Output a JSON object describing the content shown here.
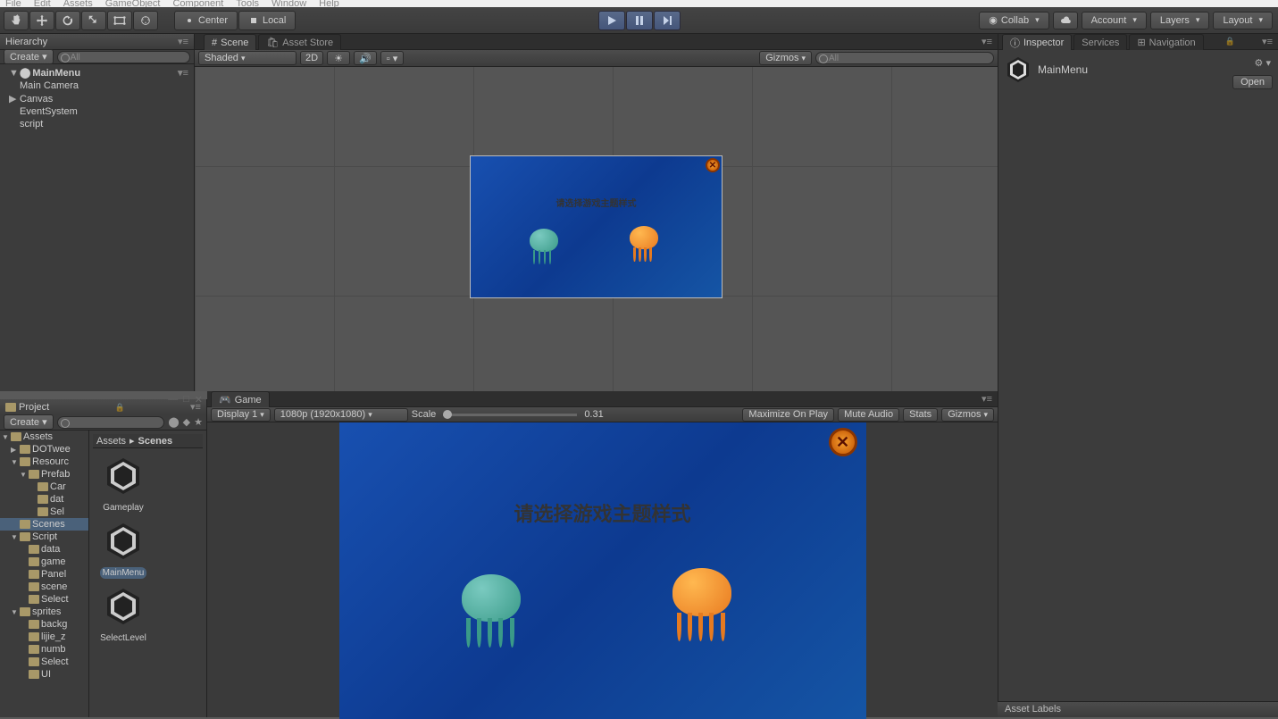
{
  "menubar": [
    "File",
    "Edit",
    "Assets",
    "GameObject",
    "Component",
    "Tools",
    "Window",
    "Help"
  ],
  "toolbar": {
    "pivot_center": "Center",
    "pivot_local": "Local",
    "collab": "Collab",
    "account": "Account",
    "layers": "Layers",
    "layout": "Layout"
  },
  "hierarchy": {
    "title": "Hierarchy",
    "create": "Create",
    "search_placeholder": "All",
    "scene": "MainMenu",
    "items": [
      "Main Camera",
      "Canvas",
      "EventSystem",
      "script"
    ]
  },
  "scene": {
    "tab_scene": "Scene",
    "tab_asset_store": "Asset Store",
    "shaded": "Shaded",
    "mode_2d": "2D",
    "gizmos": "Gizmos",
    "search_placeholder": "All"
  },
  "game": {
    "tab": "Game",
    "display": "Display 1",
    "resolution": "1080p (1920x1080)",
    "scale_label": "Scale",
    "scale_value": "0.31",
    "maximize": "Maximize On Play",
    "mute": "Mute Audio",
    "stats": "Stats",
    "gizmos": "Gizmos"
  },
  "game_content": {
    "title": "请选择游戏主题样式"
  },
  "project": {
    "title": "Project",
    "create": "Create",
    "breadcrumb_root": "Assets",
    "breadcrumb_cur": "Scenes",
    "tree": [
      {
        "name": "Assets",
        "depth": 0,
        "fold": "▼"
      },
      {
        "name": "DOTwee",
        "depth": 1,
        "fold": "▶"
      },
      {
        "name": "Resourc",
        "depth": 1,
        "fold": "▼"
      },
      {
        "name": "Prefab",
        "depth": 2,
        "fold": "▼"
      },
      {
        "name": "Car",
        "depth": 3,
        "fold": ""
      },
      {
        "name": "dat",
        "depth": 3,
        "fold": ""
      },
      {
        "name": "Sel",
        "depth": 3,
        "fold": ""
      },
      {
        "name": "Scenes",
        "depth": 1,
        "fold": "",
        "selected": true
      },
      {
        "name": "Script",
        "depth": 1,
        "fold": "▼"
      },
      {
        "name": "data",
        "depth": 2,
        "fold": ""
      },
      {
        "name": "game",
        "depth": 2,
        "fold": ""
      },
      {
        "name": "Panel",
        "depth": 2,
        "fold": ""
      },
      {
        "name": "scene",
        "depth": 2,
        "fold": ""
      },
      {
        "name": "Select",
        "depth": 2,
        "fold": ""
      },
      {
        "name": "sprites",
        "depth": 1,
        "fold": "▼"
      },
      {
        "name": "backg",
        "depth": 2,
        "fold": ""
      },
      {
        "name": "lijie_z",
        "depth": 2,
        "fold": ""
      },
      {
        "name": "numb",
        "depth": 2,
        "fold": ""
      },
      {
        "name": "Select",
        "depth": 2,
        "fold": ""
      },
      {
        "name": "UI",
        "depth": 2,
        "fold": ""
      }
    ],
    "items": [
      "Gameplay",
      "MainMenu",
      "SelectLevel"
    ],
    "selected_item": "MainMenu"
  },
  "inspector": {
    "tab_inspector": "Inspector",
    "tab_services": "Services",
    "tab_navigation": "Navigation",
    "name": "MainMenu",
    "open": "Open",
    "asset_labels": "Asset Labels"
  }
}
